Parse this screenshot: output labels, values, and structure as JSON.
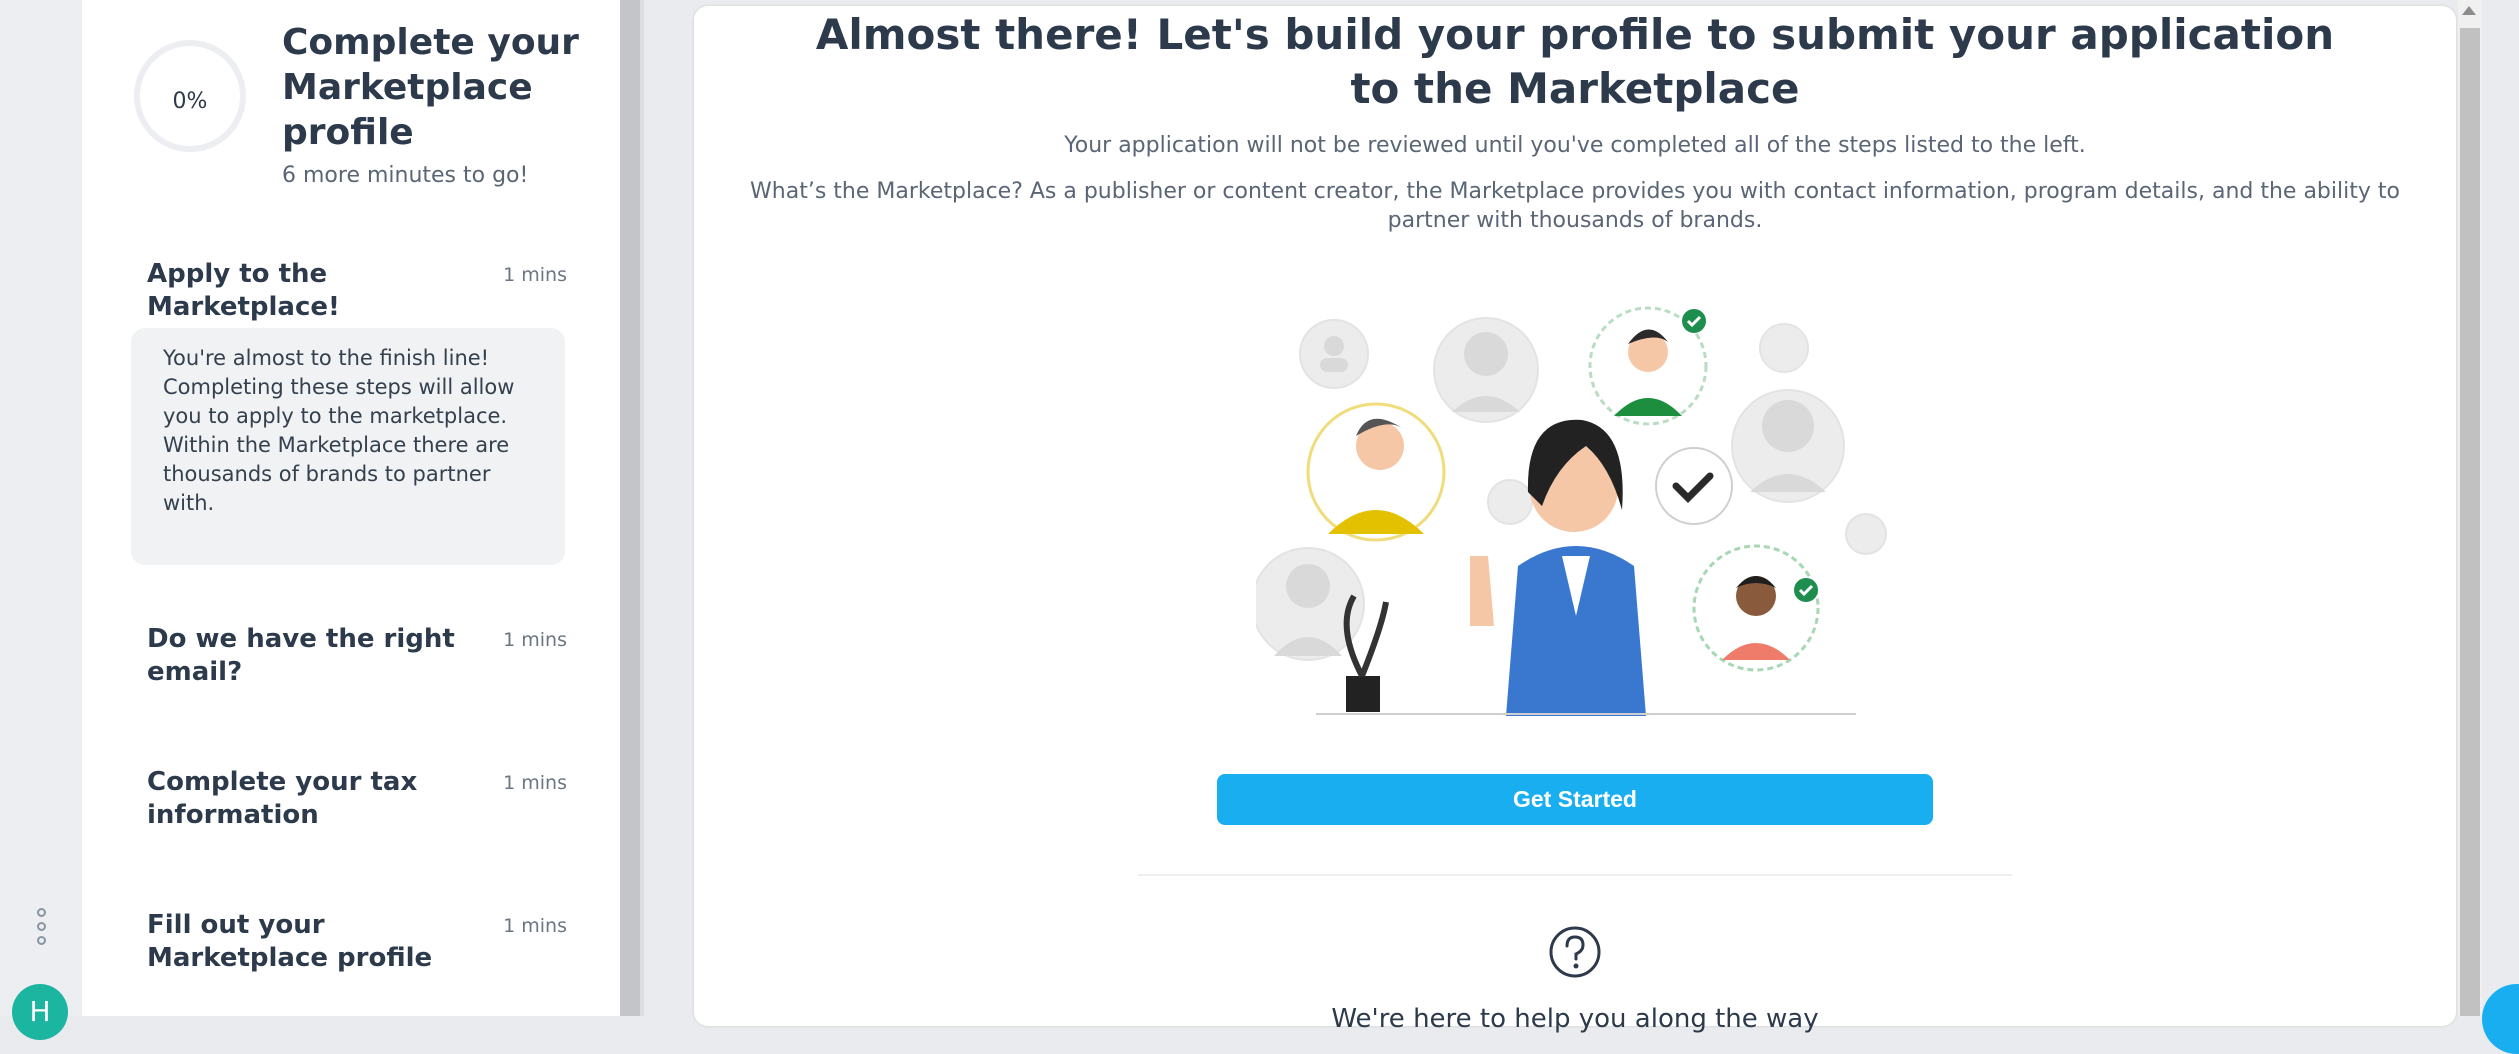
{
  "sidebar": {
    "progress_percent": 0,
    "progress_label": "0%",
    "title": "Complete your Marketplace profile",
    "subtitle": "6 more minutes to go!",
    "steps": [
      {
        "title": "Apply to the Marketplace!",
        "mins": "1 mins",
        "description": "You're almost to the finish line! Completing these steps will allow you to apply to the marketplace. Within the Marketplace there are thousands of brands to partner with."
      },
      {
        "title": "Do we have the right email?",
        "mins": "1 mins"
      },
      {
        "title": "Complete your tax information",
        "mins": "1 mins"
      },
      {
        "title": "Fill out your Marketplace profile",
        "mins": "1 mins"
      }
    ]
  },
  "rail": {
    "avatar_initial": "H",
    "menu_icon": "more-vertical-icon"
  },
  "main": {
    "heading": "Almost there! Let's build your profile to submit your application to the Marketplace",
    "note": "Your application will not be reviewed until you've completed all of the steps listed to the left.",
    "description": "What’s the Marketplace? As a publisher or content creator, the Marketplace provides you with contact information, program details, and the ability to partner with thousands of brands.",
    "cta_label": "Get Started",
    "help_icon": "question-circle-icon",
    "help_text": "We're here to help you along the way"
  },
  "colors": {
    "accent": "#18aef0",
    "avatar": "#1bb5a0",
    "check_badge": "#1e8e4e",
    "illustration_blue": "#3a78d0"
  }
}
